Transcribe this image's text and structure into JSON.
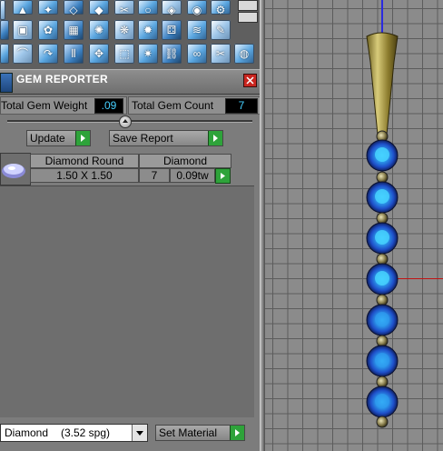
{
  "panel": {
    "title": "GEM REPORTER",
    "close_label": "x"
  },
  "stats": {
    "total_weight_label": "Total Gem Weight",
    "total_weight_value": ".09",
    "total_count_label": "Total Gem Count",
    "total_count_value": "7"
  },
  "actions": {
    "update_label": "Update",
    "save_report_label": "Save Report"
  },
  "table": {
    "headers": [
      "Diamond Round",
      "Diamond"
    ],
    "row": {
      "size": "1.50 X 1.50",
      "count": "7",
      "weight": "0.09tw"
    }
  },
  "material": {
    "selected_name": "Diamond",
    "selected_spg": "(3.52 spg)",
    "set_label": "Set Material"
  },
  "toolbar": {
    "icons": [
      "gem-icon",
      "diamond-icon",
      "prong-icon",
      "setting-icon",
      "bezel-icon",
      "cut-icon",
      "ring-icon",
      "jewel-icon",
      "bead-icon",
      "link-icon",
      "pave-icon",
      "halo-icon",
      "flower-icon",
      "facet-icon",
      "spiral-icon",
      "curve-icon",
      "pattern-icon",
      "mirror-icon",
      "move-icon",
      "array-icon",
      "shear-icon",
      "chain-icon",
      "twist-icon",
      "cutter-icon",
      "globe-icon"
    ]
  },
  "colors": {
    "panel_bg": "#7c7c7c",
    "accent_green": "#2ea33a",
    "field_text": "#46d0ff",
    "close_red": "#c9251f",
    "gem_blue": "#1e4ec8"
  }
}
